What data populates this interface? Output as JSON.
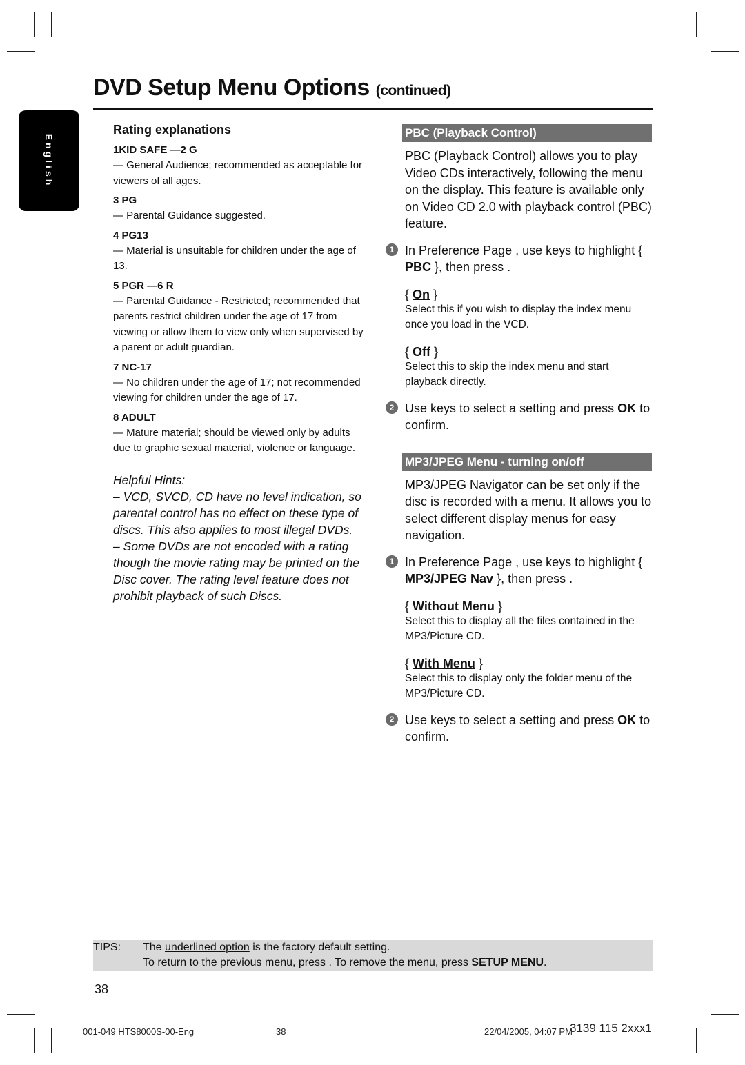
{
  "page": {
    "title": "DVD Setup Menu Options",
    "title_suffix": "(continued)",
    "language_tab": "English"
  },
  "left": {
    "heading": "Rating explanations",
    "ratings": [
      {
        "name": "1KID SAFE —2 G",
        "desc": "— General Audience; recommended as acceptable for viewers of all ages."
      },
      {
        "name": "3 PG",
        "desc": "— Parental Guidance suggested."
      },
      {
        "name": "4 PG13",
        "desc": "— Material is unsuitable for children under the age of 13."
      },
      {
        "name": "5 PGR —6 R",
        "desc": "— Parental Guidance - Restricted; recommended that parents restrict children under the age of 17 from viewing or allow them to view only when supervised by a parent or adult guardian."
      },
      {
        "name": "7 NC-17",
        "desc": "— No children under the age of 17; not recommended viewing for children under the age of 17."
      },
      {
        "name": "8  ADULT",
        "desc": "— Mature material; should be viewed only by adults due to graphic sexual material, violence or language."
      }
    ],
    "hints_title": "Helpful Hints:",
    "hints": [
      "–  VCD, SVCD, CD have no level indication, so parental control has no effect on these type of discs. This also applies to most illegal DVDs.",
      "–  Some DVDs are not encoded with a rating though the movie rating may be printed on the Disc cover. The rating level feature does not prohibit playback of such Discs."
    ]
  },
  "pbc": {
    "bar": "PBC (Playback Control)",
    "intro": "PBC (Playback Control) allows you to play Video CDs interactively, following the menu on the display. This feature is available only on Video CD 2.0 with playback control (PBC) feature.",
    "step1_a": "In  Preference Page , use        keys to highlight { ",
    "step1_bold": "PBC",
    "step1_b": " }, then press   .",
    "options": [
      {
        "name": "On",
        "default": true,
        "desc": "Select this if you wish to display the index menu once you load in the VCD."
      },
      {
        "name": "Off",
        "default": false,
        "desc": "Select this to skip the index menu and start playback directly."
      }
    ],
    "step2_a": "Use        keys to select a setting and press ",
    "step2_bold": "OK",
    "step2_b": " to confirm."
  },
  "mp3": {
    "bar": "MP3/JPEG Menu - turning on/off",
    "intro": "MP3/JPEG Navigator can be set only if the disc is recorded with a menu.  It allows you to select different display menus for easy navigation.",
    "step1_a": "In  Preference Page , use        keys to highlight { ",
    "step1_bold": "MP3/JPEG Nav",
    "step1_b": " }, then press  .",
    "options": [
      {
        "name": "Without Menu",
        "default": false,
        "desc": "Select this to display all the files contained in the MP3/Picture CD."
      },
      {
        "name": "With Menu",
        "default": true,
        "desc": "Select this to display only the folder menu of the MP3/Picture CD."
      }
    ],
    "step2_a": "Use        keys to select a setting and press ",
    "step2_bold": "OK",
    "step2_b": " to confirm."
  },
  "badges": {
    "one": "1",
    "two": "2"
  },
  "tips": {
    "label": "TIPS:",
    "l1_a": "The ",
    "l1_u": "underlined option",
    "l1_b": " is the factory default setting.",
    "l2_a": "To return to the previous menu, press   .  To remove the menu, press ",
    "l2_bold": "SETUP MENU",
    "l2_b": "."
  },
  "page_number": "38",
  "footer": {
    "file": "001-049 HTS8000S-00-Eng",
    "page": "38",
    "date": "22/04/2005, 04:07 PM",
    "code": "3139 115 2xxx1"
  }
}
